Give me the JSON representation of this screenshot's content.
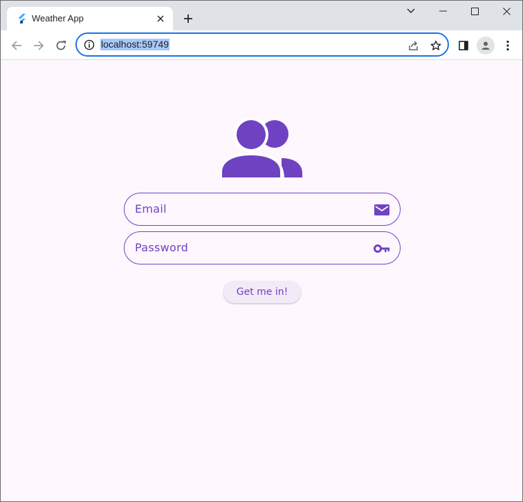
{
  "browser": {
    "tab": {
      "title": "Weather App",
      "favicon": "flutter-logo-icon"
    },
    "address": {
      "url": "localhost:59749"
    },
    "colors": {
      "accent": "#1a73e8",
      "url_highlight": "#a8c7fa"
    }
  },
  "app": {
    "header_icon": "users-icon",
    "email": {
      "label": "Email",
      "icon": "envelope-icon"
    },
    "password": {
      "label": "Password",
      "icon": "key-icon"
    },
    "submit_label": "Get me in!",
    "colors": {
      "primary": "#6f42c1",
      "background": "#fef7fe",
      "button_bg": "#f3eaf7"
    }
  }
}
